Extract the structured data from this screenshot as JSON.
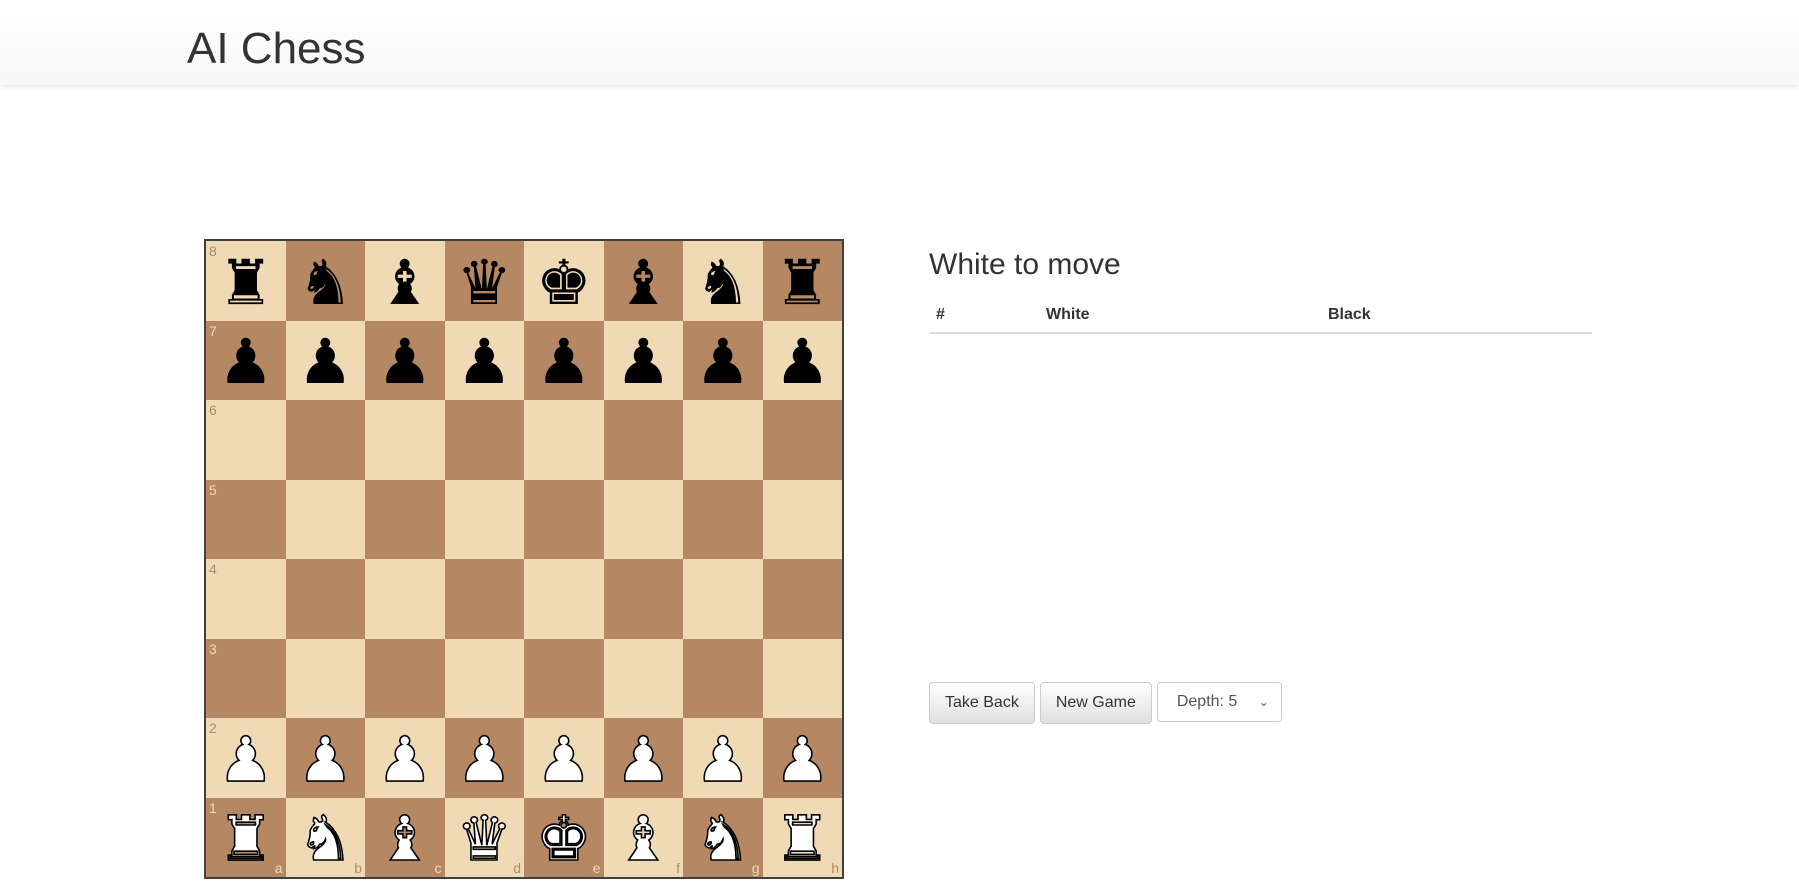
{
  "app": {
    "title": "AI Chess"
  },
  "status": {
    "text": "White to move"
  },
  "moves_table": {
    "headers": [
      "#",
      "White",
      "Black"
    ],
    "rows": []
  },
  "controls": {
    "take_back_label": "Take Back",
    "new_game_label": "New Game",
    "depth_label": "Depth: 5",
    "depth_chevron_icon": "chevron-down-icon"
  },
  "board": {
    "colors": {
      "light": "#f0d9b5",
      "dark": "#b58863"
    },
    "files": [
      "a",
      "b",
      "c",
      "d",
      "e",
      "f",
      "g",
      "h"
    ],
    "ranks": [
      "8",
      "7",
      "6",
      "5",
      "4",
      "3",
      "2",
      "1"
    ],
    "position": [
      [
        "br",
        "bn",
        "bb",
        "bq",
        "bk",
        "bb",
        "bn",
        "br"
      ],
      [
        "bp",
        "bp",
        "bp",
        "bp",
        "bp",
        "bp",
        "bp",
        "bp"
      ],
      [
        "",
        "",
        "",
        "",
        "",
        "",
        "",
        ""
      ],
      [
        "",
        "",
        "",
        "",
        "",
        "",
        "",
        ""
      ],
      [
        "",
        "",
        "",
        "",
        "",
        "",
        "",
        ""
      ],
      [
        "",
        "",
        "",
        "",
        "",
        "",
        "",
        ""
      ],
      [
        "wp",
        "wp",
        "wp",
        "wp",
        "wp",
        "wp",
        "wp",
        "wp"
      ],
      [
        "wr",
        "wn",
        "wb",
        "wq",
        "wk",
        "wb",
        "wn",
        "wr"
      ]
    ]
  }
}
